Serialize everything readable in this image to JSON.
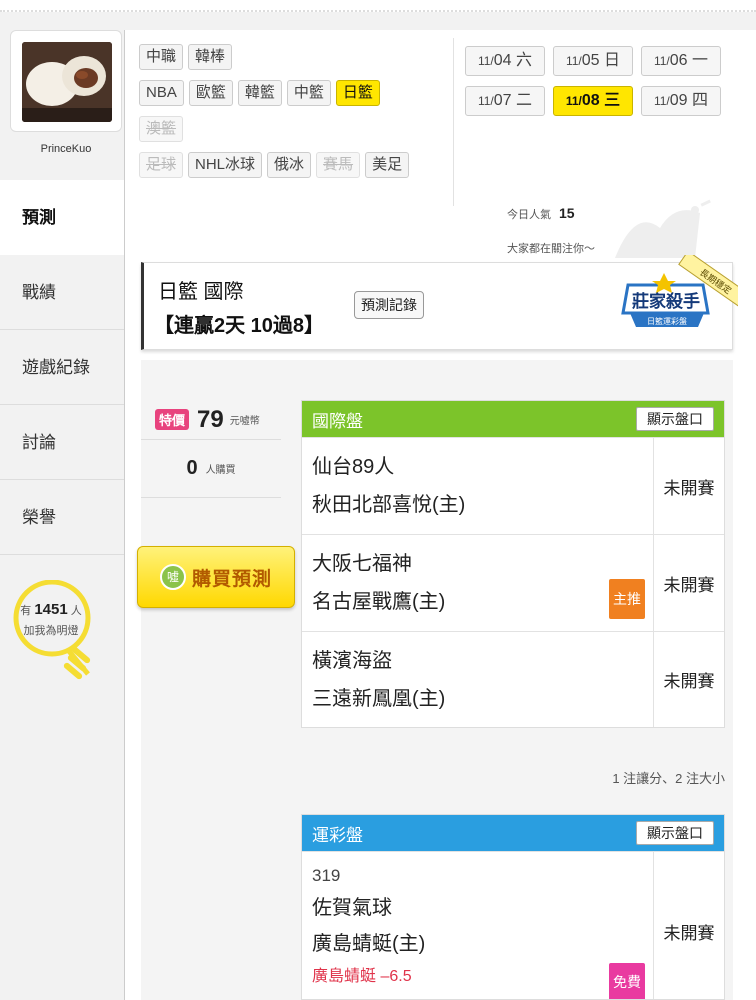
{
  "user": {
    "name": "PrinceKuo"
  },
  "sidebar": {
    "items": [
      {
        "label": "預測"
      },
      {
        "label": "戰績"
      },
      {
        "label": "遊戲紀錄"
      },
      {
        "label": "討論"
      },
      {
        "label": "榮譽"
      }
    ],
    "fans_prefix": "有",
    "fans_count": "1451",
    "fans_suffix": "人",
    "fans_line2": "加我為明燈"
  },
  "filters": {
    "row1": [
      "中職",
      "韓棒"
    ],
    "row2": [
      "NBA",
      "歐籃",
      "韓籃",
      "中籃",
      "日籃"
    ],
    "row3": [
      "澳籃"
    ],
    "row4": [
      "足球",
      "NHL冰球",
      "俄冰",
      "賽馬",
      "美足"
    ],
    "selected": "日籃"
  },
  "dates": {
    "row1": [
      {
        "m": "11/",
        "d": "04",
        "w": "六"
      },
      {
        "m": "11/",
        "d": "05",
        "w": "日"
      },
      {
        "m": "11/",
        "d": "06",
        "w": "一"
      }
    ],
    "row2": [
      {
        "m": "11/",
        "d": "07",
        "w": "二"
      },
      {
        "m": "11/",
        "d": "08",
        "w": "三"
      },
      {
        "m": "11/",
        "d": "09",
        "w": "四"
      }
    ],
    "selected": "11/08"
  },
  "popularity": {
    "label": "今日人氣",
    "value": "15",
    "watching": "大家都在關注你～"
  },
  "league": {
    "name": "日籃 國際",
    "streak": "【連贏2天 10過8】",
    "record_button": "預測記錄",
    "badge_title": "莊家殺手",
    "badge_sub": "日籃運彩盤",
    "badge_ribbon": "長期穩定"
  },
  "purchase": {
    "special_label": "特價",
    "price": "79",
    "unit": "元噓幣",
    "buyers": "0",
    "buyers_unit": "人購買",
    "buy_button": "購買預測",
    "coin": "噓"
  },
  "intl_board": {
    "title": "國際盤",
    "show_button": "顯示盤口",
    "color": "#7cc42a",
    "games": [
      {
        "away": "仙台89人",
        "home": "秋田北部喜悅(主)",
        "status": "未開賽",
        "tag": ""
      },
      {
        "away": "大阪七福神",
        "home": "名古屋戰鷹(主)",
        "status": "未開賽",
        "tag": "主推"
      },
      {
        "away": "橫濱海盜",
        "home": "三遠新鳳凰(主)",
        "status": "未開賽",
        "tag": ""
      }
    ],
    "note": "1 注讓分、2 注大小"
  },
  "lottery_board": {
    "title": "運彩盤",
    "show_button": "顯示盤口",
    "color": "#2a9ee0",
    "games": [
      {
        "id": "319",
        "away": "佐賀氣球",
        "home": "廣島蜻蜓(主)",
        "spread": "廣島蜻蜓 –6.5",
        "status": "未開賽",
        "tag": "免費"
      }
    ]
  }
}
